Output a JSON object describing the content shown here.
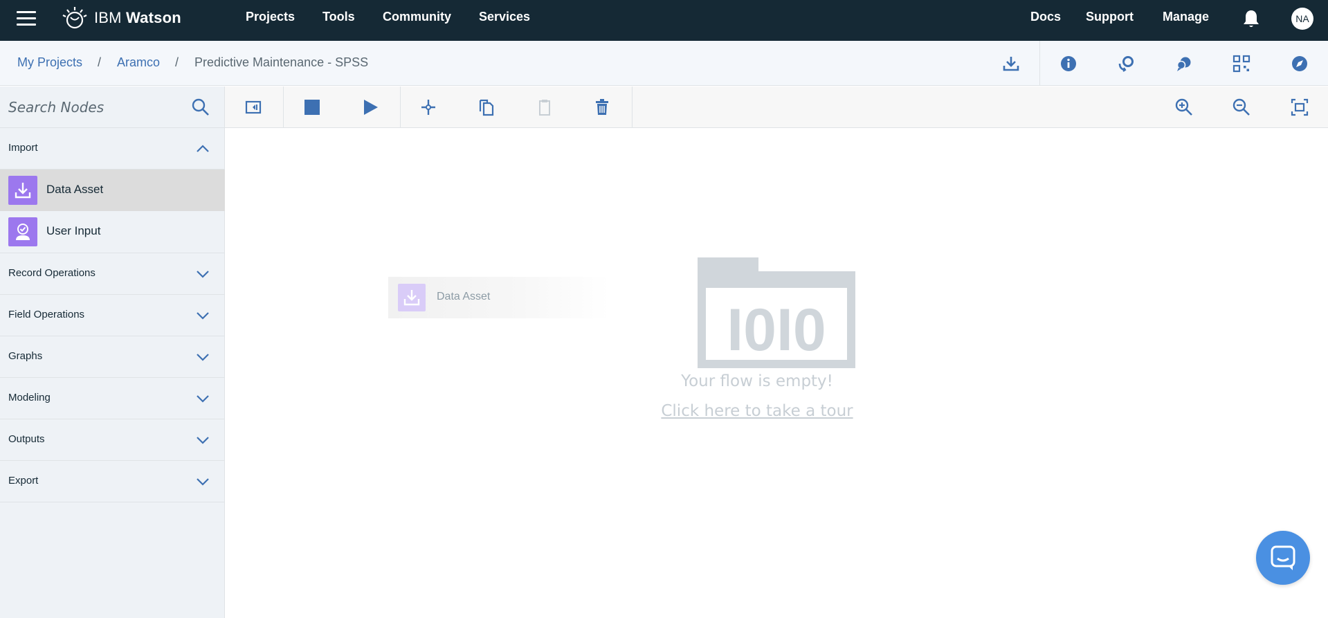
{
  "topnav": {
    "brand_prefix": "IBM ",
    "brand_name": "Watson",
    "links": [
      "Projects",
      "Tools",
      "Community",
      "Services"
    ],
    "right_links": [
      "Docs",
      "Support",
      "Manage"
    ],
    "avatar_initials": "NA"
  },
  "breadcrumb": {
    "items": [
      "My Projects",
      "Aramco",
      "Predictive Maintenance - SPSS"
    ],
    "separator": "/"
  },
  "palette": {
    "search_placeholder": "Search Nodes",
    "categories": [
      "Import",
      "Record Operations",
      "Field Operations",
      "Graphs",
      "Modeling",
      "Outputs",
      "Export"
    ],
    "import_nodes": [
      "Data Asset",
      "User Input"
    ],
    "selected_node": "Data Asset"
  },
  "canvas": {
    "drag_ghost_label": "Data Asset",
    "empty_title": "Your flow is empty!",
    "empty_link": "Click here to take a tour",
    "empty_graphic_text": "I0I0"
  },
  "colors": {
    "nav_bg": "#152935",
    "link_blue": "#3d70b2",
    "node_purple": "#9c78ee",
    "chat_blue": "#4a90e2"
  }
}
